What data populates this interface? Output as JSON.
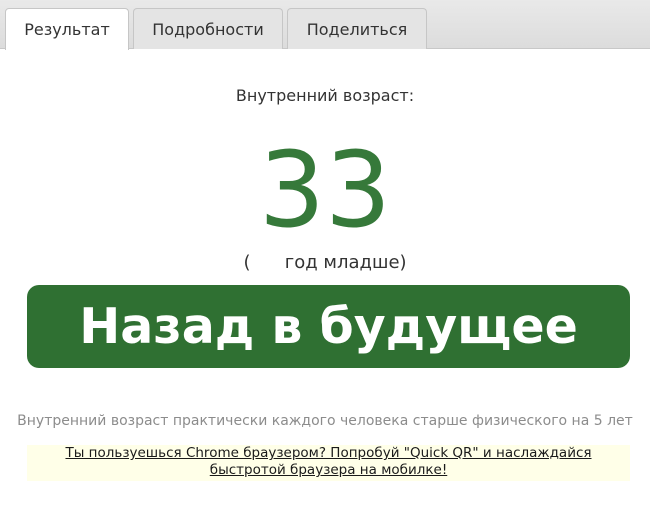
{
  "tabs": [
    {
      "label": "Результат",
      "active": true
    },
    {
      "label": "Подробности",
      "active": false
    },
    {
      "label": "Поделиться",
      "active": false
    }
  ],
  "result": {
    "label": "Внутренний возраст:",
    "age": "33",
    "diff_text": "(      год младше)"
  },
  "cta": {
    "label": "Назад в будущее"
  },
  "info": "Внутренний возраст практически каждого человека старше физического на 5 лет",
  "promo": {
    "line1": "Ты пользуешься Chrome браузером? Попробуй \"Quick QR\" и наслаждайся",
    "line2": "быстротой браузера на мобилке!"
  },
  "colors": {
    "accent": "#36793a",
    "button_bg": "#2f7032",
    "promo_bg": "#ffffe8"
  }
}
